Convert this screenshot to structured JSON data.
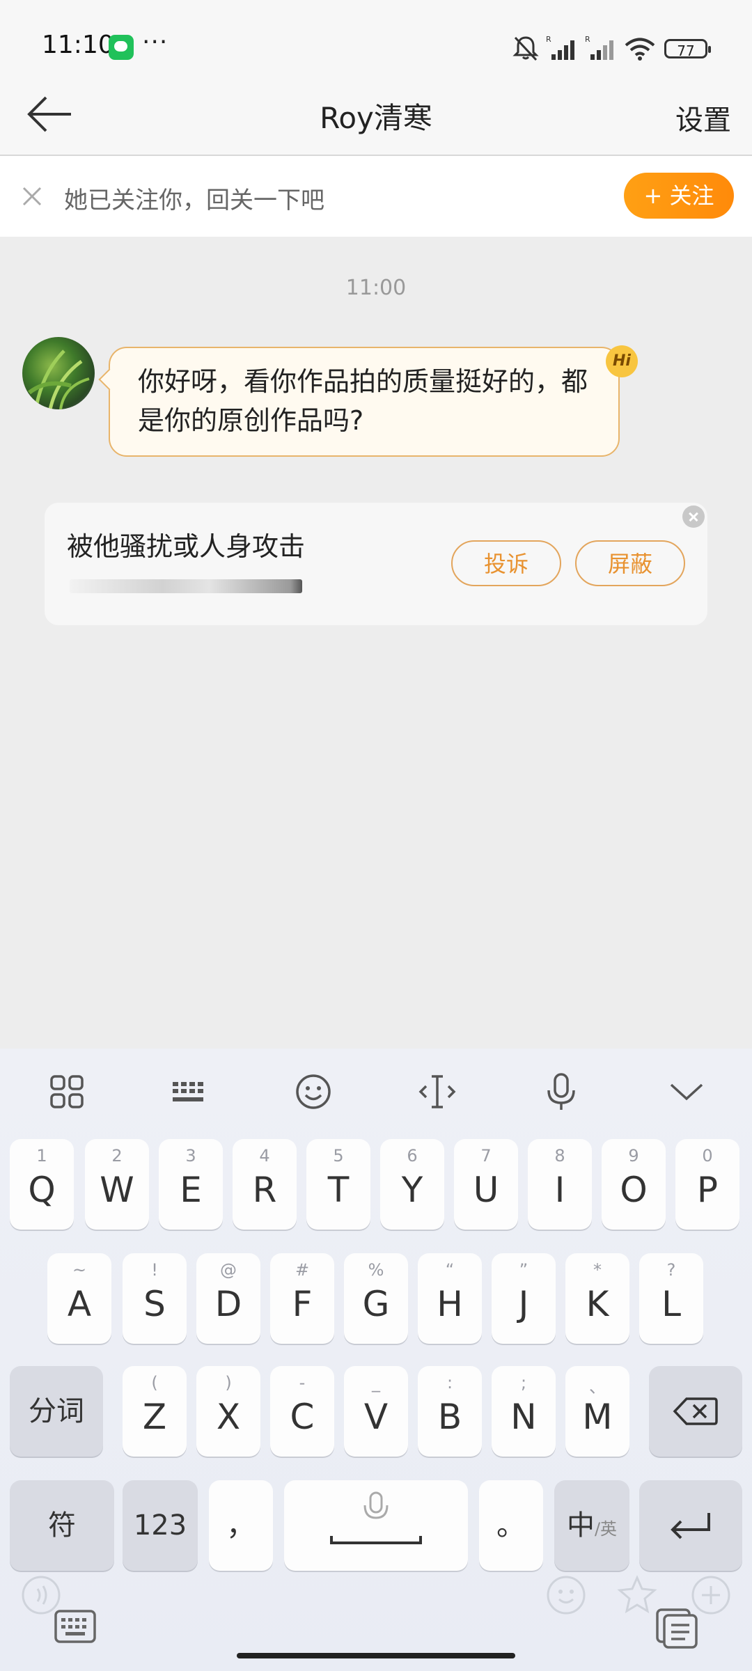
{
  "status_bar": {
    "time": "11:10",
    "more": "···",
    "battery": "77"
  },
  "header": {
    "title": "Roy清寒",
    "settings_label": "设置"
  },
  "follow_banner": {
    "text": "她已关注你，回关一下吧",
    "button_label": "+ 关注"
  },
  "chat": {
    "timestamp": "11:00",
    "message": "你好呀，看你作品拍的质量挺好的，都是你的原创作品吗?",
    "badge": "Hi"
  },
  "report_card": {
    "title": "被他骚扰或人身攻击",
    "complain_label": "投诉",
    "block_label": "屏蔽"
  },
  "keyboard": {
    "toolbar": [
      "menu-grid-icon",
      "keyboard-layout-icon",
      "emoji-icon",
      "cursor-icon",
      "mic-icon",
      "collapse-icon"
    ],
    "row1": [
      {
        "main": "Q",
        "sub": "1"
      },
      {
        "main": "W",
        "sub": "2"
      },
      {
        "main": "E",
        "sub": "3"
      },
      {
        "main": "R",
        "sub": "4"
      },
      {
        "main": "T",
        "sub": "5"
      },
      {
        "main": "Y",
        "sub": "6"
      },
      {
        "main": "U",
        "sub": "7"
      },
      {
        "main": "I",
        "sub": "8"
      },
      {
        "main": "O",
        "sub": "9"
      },
      {
        "main": "P",
        "sub": "0"
      }
    ],
    "row2": [
      {
        "main": "A",
        "sub": "~"
      },
      {
        "main": "S",
        "sub": "!"
      },
      {
        "main": "D",
        "sub": "@"
      },
      {
        "main": "F",
        "sub": "#"
      },
      {
        "main": "G",
        "sub": "%"
      },
      {
        "main": "H",
        "sub": "“"
      },
      {
        "main": "J",
        "sub": "”"
      },
      {
        "main": "K",
        "sub": "*"
      },
      {
        "main": "L",
        "sub": "?"
      }
    ],
    "row3": [
      {
        "main": "Z",
        "sub": "("
      },
      {
        "main": "X",
        "sub": ")"
      },
      {
        "main": "C",
        "sub": "-"
      },
      {
        "main": "V",
        "sub": "_"
      },
      {
        "main": "B",
        "sub": ":"
      },
      {
        "main": "N",
        "sub": ";"
      },
      {
        "main": "M",
        "sub": "、"
      }
    ],
    "segment_label": "分词",
    "symbol_label": "符",
    "num_label": "123",
    "comma_label": "，",
    "period_label": "。",
    "lang_label": "中",
    "lang_sub_label": "/英"
  }
}
